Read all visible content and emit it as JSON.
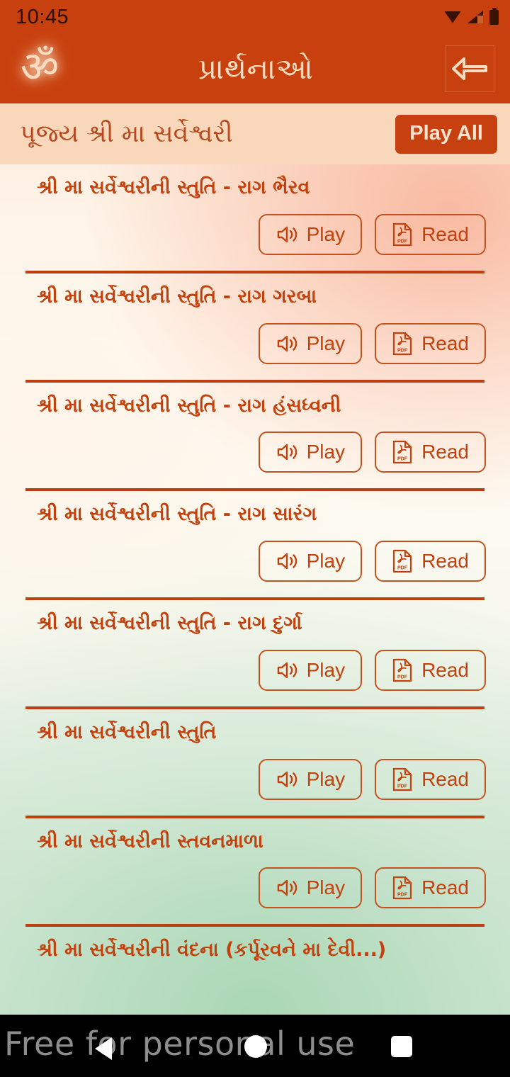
{
  "status_bar": {
    "clock": "10:45",
    "icons": [
      "wifi-icon",
      "cellular-signal-icon",
      "battery-icon"
    ]
  },
  "app_bar": {
    "logo_glyph": "ॐ",
    "logo_name": "om-icon",
    "title": "પ્રાર્થનાઓ",
    "back_name": "back-arrow-icon"
  },
  "section": {
    "title": "પૂજ્ય શ્રી મા સર્વેશ્વરી",
    "play_all_label": "Play All"
  },
  "labels": {
    "play": "Play",
    "read": "Read",
    "pdf_tag": "PDF"
  },
  "items": [
    {
      "title": "શ્રી મા સર્વેશ્વરીની સ્તુતિ - રાગ ભૈરવ"
    },
    {
      "title": "શ્રી મા સર્વેશ્વરીની સ્તુતિ - રાગ ગરબા"
    },
    {
      "title": "શ્રી મા સર્વેશ્વરીની સ્તુતિ - રાગ હંસધ્વની"
    },
    {
      "title": "શ્રી મા સર્વેશ્વરીની સ્તુતિ - રાગ સારંગ"
    },
    {
      "title": "શ્રી મા સર્વેશ્વરીની સ્તુતિ - રાગ દુર્ગા"
    },
    {
      "title": "શ્રી મા સર્વેશ્વરીની સ્તુતિ"
    },
    {
      "title": "શ્રી મા સર્વેશ્વરીની સ્તવનમાળા"
    },
    {
      "title": "શ્રી મા સર્વેશ્વરીની વંદના (કર્પૂરવને મા દેવી...)"
    }
  ],
  "nav_bar": {
    "watermark": "Free for personal use",
    "buttons": [
      "back-triangle-icon",
      "home-circle-icon",
      "recents-square-icon"
    ]
  },
  "colors": {
    "brand": "#c8400d",
    "accent_text": "#c2410c",
    "section_bg": "#f9d7bb",
    "divider": "#bb3f10",
    "on_brand": "#fbdcc1"
  }
}
